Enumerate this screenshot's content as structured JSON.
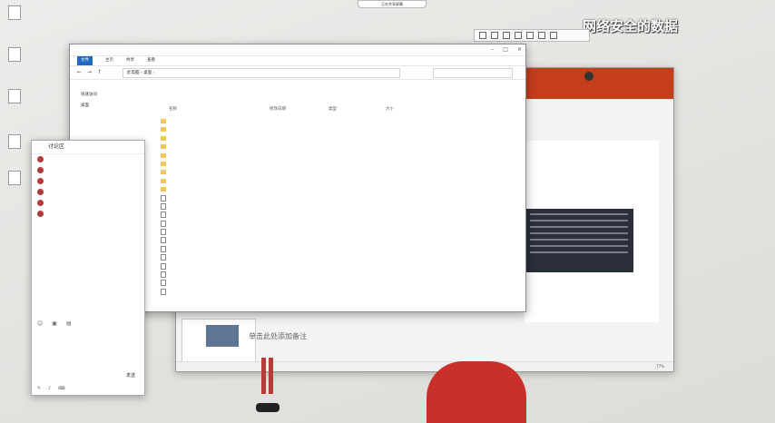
{
  "topbar": {
    "label": "正在共享屏幕"
  },
  "banner": {
    "text": "网络安全的数据"
  },
  "desktop": {
    "icons": [
      {
        "label": ""
      },
      {
        "label": ""
      },
      {
        "label": ""
      },
      {
        "label": ""
      },
      {
        "label": ""
      }
    ]
  },
  "ppt": {
    "user": "",
    "share": "",
    "notes_placeholder": "单击此处添加备注",
    "status_left": "",
    "status_right": "77%"
  },
  "explorer": {
    "title": "",
    "ribbon": [
      "文件",
      "主页",
      "共享",
      "查看"
    ],
    "path": "此电脑 › 桌面 ›",
    "search_placeholder": "",
    "nav": [
      "快速访问",
      "桌面"
    ],
    "columns": {
      "name": "名称",
      "date": "修改日期",
      "type": "类型",
      "size": "大小"
    },
    "files": [
      {
        "name": "",
        "date": "",
        "type": "",
        "size": "",
        "kind": "folder"
      },
      {
        "name": "",
        "date": "",
        "type": "",
        "size": "",
        "kind": "folder"
      },
      {
        "name": "",
        "date": "",
        "type": "",
        "size": "",
        "kind": "folder"
      },
      {
        "name": "",
        "date": "",
        "type": "",
        "size": "",
        "kind": "folder"
      },
      {
        "name": "",
        "date": "",
        "type": "",
        "size": "",
        "kind": "folder"
      },
      {
        "name": "",
        "date": "",
        "type": "",
        "size": "",
        "kind": "folder"
      },
      {
        "name": "",
        "date": "",
        "type": "",
        "size": "",
        "kind": "folder"
      },
      {
        "name": "",
        "date": "",
        "type": "",
        "size": "",
        "kind": "folder"
      },
      {
        "name": "",
        "date": "",
        "type": "",
        "size": "",
        "kind": "folder"
      },
      {
        "name": "",
        "date": "",
        "type": "",
        "size": "",
        "kind": "file"
      },
      {
        "name": "",
        "date": "",
        "type": "",
        "size": "",
        "kind": "file"
      },
      {
        "name": "",
        "date": "",
        "type": "",
        "size": "",
        "kind": "file"
      },
      {
        "name": "",
        "date": "",
        "type": "",
        "size": "",
        "kind": "file"
      },
      {
        "name": "",
        "date": "",
        "type": "",
        "size": "",
        "kind": "file"
      },
      {
        "name": "",
        "date": "",
        "type": "",
        "size": "",
        "kind": "file"
      },
      {
        "name": "",
        "date": "",
        "type": "",
        "size": "",
        "kind": "file"
      },
      {
        "name": "",
        "date": "",
        "type": "",
        "size": "",
        "kind": "file"
      },
      {
        "name": "",
        "date": "",
        "type": "",
        "size": "",
        "kind": "file"
      },
      {
        "name": "",
        "date": "",
        "type": "",
        "size": "",
        "kind": "file"
      },
      {
        "name": "",
        "date": "",
        "type": "",
        "size": "",
        "kind": "file"
      },
      {
        "name": "",
        "date": "",
        "type": "",
        "size": "",
        "kind": "file"
      }
    ]
  },
  "chat": {
    "title": "讨论区",
    "messages": [
      {
        "who": "",
        "text": ""
      },
      {
        "who": "",
        "text": ""
      },
      {
        "who": "",
        "text": ""
      },
      {
        "who": "",
        "text": ""
      },
      {
        "who": "",
        "text": ""
      },
      {
        "who": "",
        "text": ""
      }
    ],
    "send": "发送"
  }
}
